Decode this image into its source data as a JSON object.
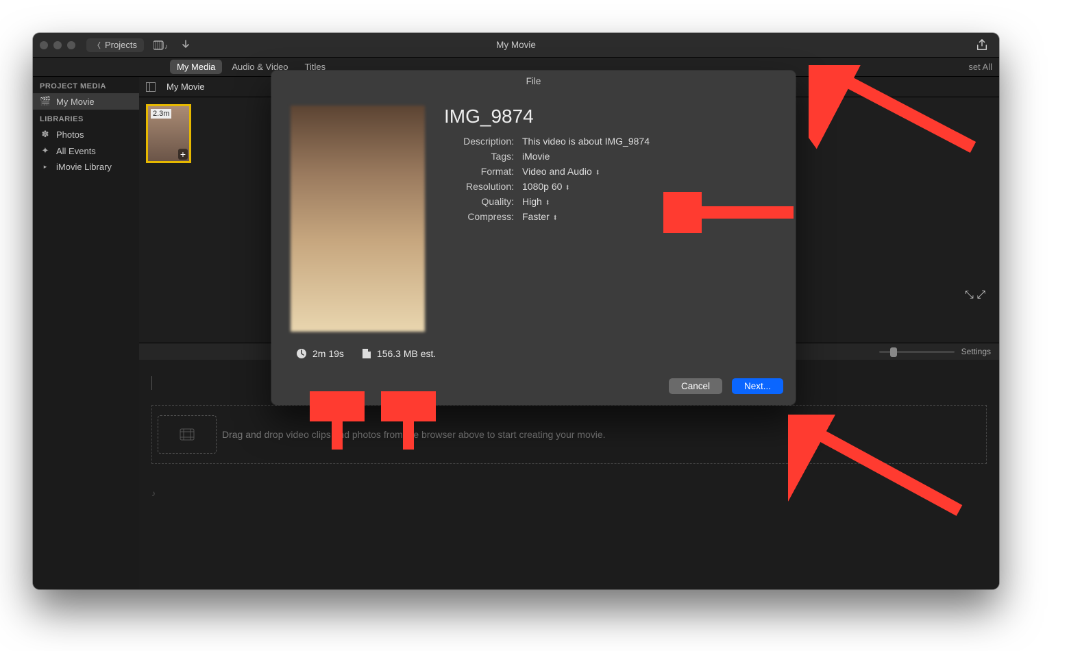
{
  "window": {
    "title": "My Movie",
    "back_label": "Projects",
    "reset_all": "set All"
  },
  "tabs": [
    "My Media",
    "Audio & Video",
    "Titles"
  ],
  "active_tab": "My Media",
  "sidebar": {
    "project_media_hdr": "PROJECT MEDIA",
    "project_media_item": "My Movie",
    "libraries_hdr": "LIBRARIES",
    "photos": "Photos",
    "all_events": "All Events",
    "imovie_library": "iMovie Library"
  },
  "browser": {
    "title": "My Movie",
    "clip_duration": "2.3m"
  },
  "timeline": {
    "hint": "Drag and drop video clips and photos from the browser above to start creating your movie.",
    "settings": "Settings"
  },
  "dialog": {
    "title": "File",
    "file_title": "IMG_9874",
    "labels": {
      "description": "Description:",
      "tags": "Tags:",
      "format": "Format:",
      "resolution": "Resolution:",
      "quality": "Quality:",
      "compress": "Compress:"
    },
    "values": {
      "description": "This video is about IMG_9874",
      "tags": "iMovie",
      "format": "Video and Audio",
      "resolution": "1080p 60",
      "quality": "High",
      "compress": "Faster"
    },
    "stats": {
      "duration": "2m 19s",
      "size": "156.3 MB est."
    },
    "buttons": {
      "cancel": "Cancel",
      "next": "Next..."
    }
  }
}
